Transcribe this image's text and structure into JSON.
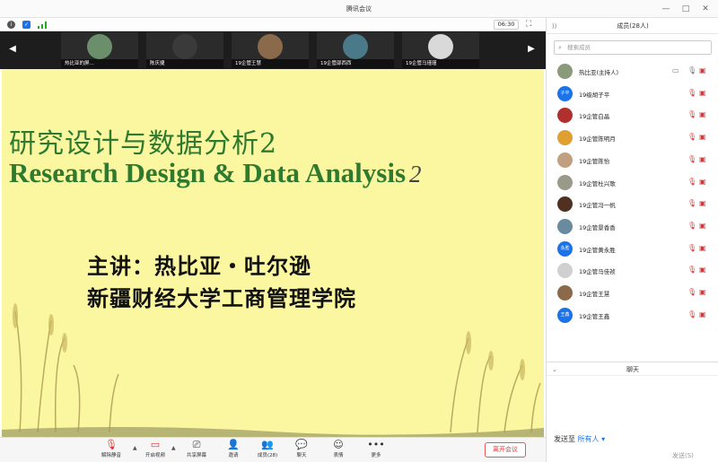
{
  "window": {
    "title": "腾讯会议"
  },
  "topbar": {
    "timer": "06:30"
  },
  "strip": {
    "tiles": [
      {
        "name": "热比亚的屏...",
        "color": "#6b8f6b"
      },
      {
        "name": "陈庆捷",
        "color": "#3a3a3a"
      },
      {
        "name": "19企管王慧",
        "color": "#8a6a4a"
      },
      {
        "name": "19企管邵西西",
        "color": "#4a7a8a"
      },
      {
        "name": "19企管马瑾瑾",
        "color": "#d9d9d9"
      }
    ]
  },
  "slide": {
    "title_cn": "研究设计与数据分析2",
    "title_en": "Research Design & Data Analysis",
    "title_en_num": "2",
    "lecturer": "主讲：热比亚・吐尔逊",
    "school": "新疆财经大学工商管理学院"
  },
  "toolbar": {
    "unmute": "解除静音",
    "video": "开启视频",
    "share": "共享屏幕",
    "invite": "邀请",
    "members": "成员(28)",
    "chat": "聊天",
    "emoji": "表情",
    "more": "更多",
    "leave": "离开会议"
  },
  "panel": {
    "header": "成员(28人)",
    "search_placeholder": "搜索成员",
    "members": [
      {
        "name": "热比亚(主持人)",
        "avatar": "",
        "color": "#8a9a7a",
        "host": true
      },
      {
        "name": "19级胡子平",
        "avatar": "子平",
        "color": "#1a73e8"
      },
      {
        "name": "19企管白晶",
        "avatar": "",
        "color": "#b03030"
      },
      {
        "name": "19企管陈明月",
        "avatar": "",
        "color": "#e0a030"
      },
      {
        "name": "19企管陈怡",
        "avatar": "",
        "color": "#c0a080"
      },
      {
        "name": "19企管杜兴歌",
        "avatar": "",
        "color": "#9a9a8a"
      },
      {
        "name": "19企管冯一帆",
        "avatar": "",
        "color": "#503020"
      },
      {
        "name": "19企管景香香",
        "avatar": "",
        "color": "#6a8aa0"
      },
      {
        "name": "19企管黄永胜",
        "avatar": "永胜",
        "color": "#1a73e8"
      },
      {
        "name": "19企管马佳祯",
        "avatar": "",
        "color": "#d0d0d0"
      },
      {
        "name": "19企管王慧",
        "avatar": "",
        "color": "#8a6a4a"
      },
      {
        "name": "19企管王鑫",
        "avatar": "王鑫",
        "color": "#1a73e8"
      }
    ],
    "chat_header": "聊天",
    "send_to_label": "发送至",
    "send_to_value": "所有人",
    "send_button": "发送(S)"
  },
  "colors": {
    "slide_bg": "#fbf6a0",
    "title_green": "#2e7a2e",
    "leave_red": "#e33333",
    "accent": "#1a73e8"
  }
}
